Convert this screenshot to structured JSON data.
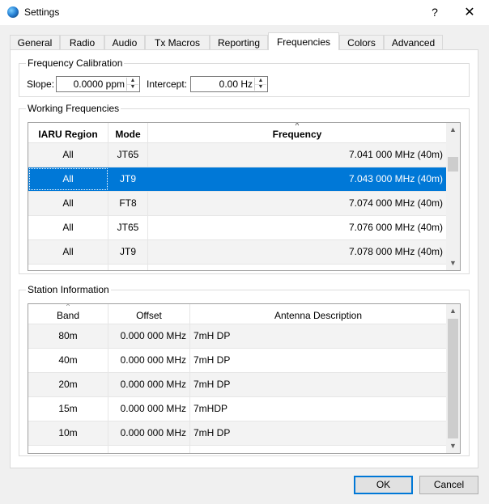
{
  "window": {
    "title": "Settings",
    "help_glyph": "?",
    "close_glyph": "✕"
  },
  "tabs": [
    {
      "label": "General"
    },
    {
      "label": "Radio"
    },
    {
      "label": "Audio"
    },
    {
      "label": "Tx Macros"
    },
    {
      "label": "Reporting"
    },
    {
      "label": "Frequencies"
    },
    {
      "label": "Colors"
    },
    {
      "label": "Advanced"
    }
  ],
  "active_tab": "Frequencies",
  "calibration": {
    "title": "Frequency Calibration",
    "slope_label": "Slope:",
    "slope_value": "0.0000 ppm",
    "intercept_label": "Intercept:",
    "intercept_value": "0.00 Hz"
  },
  "working": {
    "title": "Working Frequencies",
    "columns": [
      "IARU Region",
      "Mode",
      "Frequency"
    ],
    "rows": [
      {
        "region": "All",
        "mode": "JT65",
        "freq": "7.041 000 MHz (40m)"
      },
      {
        "region": "All",
        "mode": "JT9",
        "freq": "7.043 000 MHz (40m)"
      },
      {
        "region": "All",
        "mode": "FT8",
        "freq": "7.074 000 MHz (40m)"
      },
      {
        "region": "All",
        "mode": "JT65",
        "freq": "7.076 000 MHz (40m)"
      },
      {
        "region": "All",
        "mode": "JT9",
        "freq": "7.078 000 MHz (40m)"
      }
    ],
    "selected_index": 1
  },
  "station": {
    "title": "Station Information",
    "columns": [
      "Band",
      "Offset",
      "Antenna Description"
    ],
    "rows": [
      {
        "band": "80m",
        "offset": "0.000 000 MHz",
        "antenna": "7mH DP"
      },
      {
        "band": "40m",
        "offset": "0.000 000 MHz",
        "antenna": "7mH DP"
      },
      {
        "band": "20m",
        "offset": "0.000 000 MHz",
        "antenna": "7mH DP"
      },
      {
        "band": "15m",
        "offset": "0.000 000 MHz",
        "antenna": "7mHDP"
      },
      {
        "band": "10m",
        "offset": "0.000 000 MHz",
        "antenna": "7mH DP"
      }
    ]
  },
  "buttons": {
    "ok": "OK",
    "cancel": "Cancel"
  },
  "icons": {
    "scroll_up": "▲",
    "scroll_down": "▼",
    "sort": "^",
    "spin_up": "▲",
    "spin_down": "▼"
  },
  "colors": {
    "selection": "#0078d7",
    "button_default_border": "#0078d7"
  }
}
